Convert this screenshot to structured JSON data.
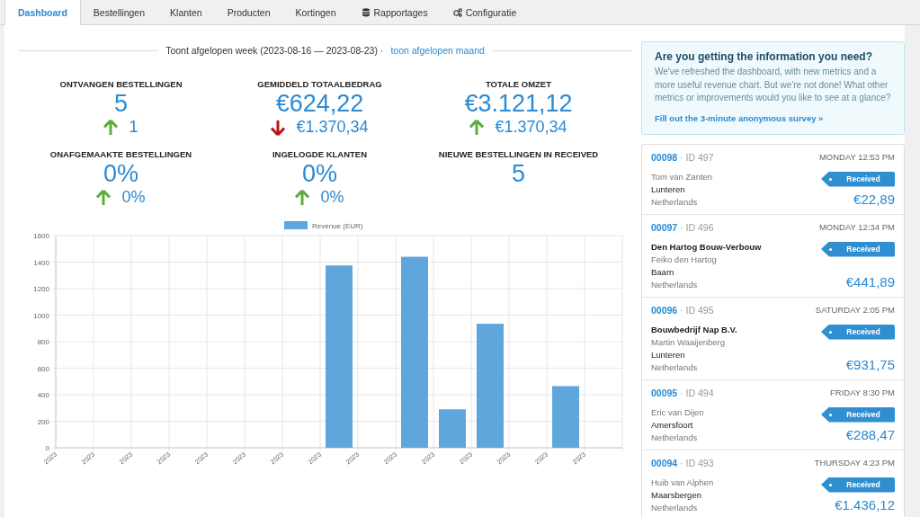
{
  "tabs": [
    {
      "label": "Dashboard",
      "selected": true,
      "kind": "plain"
    },
    {
      "label": "Bestellingen",
      "selected": false,
      "kind": "plain"
    },
    {
      "label": "Klanten",
      "selected": false,
      "kind": "plain"
    },
    {
      "label": "Producten",
      "selected": false,
      "kind": "plain"
    },
    {
      "label": "Kortingen",
      "selected": false,
      "kind": "plain"
    },
    {
      "label": "Rapportages",
      "selected": false,
      "kind": "database"
    },
    {
      "label": "Configuratie",
      "selected": false,
      "kind": "cogs"
    }
  ],
  "period": {
    "text": "Toont afgelopen week (2023-08-16 — 2023-08-23) ·",
    "link": "toon afgelopen maand"
  },
  "metrics": [
    {
      "label": "ONTVANGEN BESTELLINGEN",
      "value": "5",
      "change": {
        "increase": true,
        "text": "1"
      }
    },
    {
      "label": "GEMIDDELD TOTAALBEDRAG",
      "value": "€624,22",
      "change": {
        "increase": false,
        "text": "€1.370,34"
      }
    },
    {
      "label": "TOTALE OMZET",
      "value": "€3.121,12",
      "change": {
        "increase": true,
        "text": "€1.370,34"
      }
    },
    {
      "label": "ONAFGEMAAKTE BESTELLINGEN",
      "value": "0%",
      "change": {
        "increase": true,
        "text": "0%"
      }
    },
    {
      "label": "INGELOGDE KLANTEN",
      "value": "0%",
      "change": {
        "increase": true,
        "text": "0%"
      }
    },
    {
      "label": "NIEUWE BESTELLINGEN IN RECEIVED",
      "value": "5"
    }
  ],
  "chart": {
    "chart_data": {
      "type": "bar",
      "categories": [
        "2023",
        "2023",
        "2023",
        "2023",
        "2023",
        "2023",
        "2023",
        "2023",
        "2023",
        "2023",
        "2023",
        "2023",
        "2023",
        "2023",
        "2023"
      ],
      "series": [
        {
          "name": "Revenue (EUR)",
          "color": "#5ea6dc",
          "values": [
            0,
            0,
            0,
            0,
            0,
            0,
            0,
            1375,
            0,
            1440,
            290,
            935,
            0,
            465,
            0
          ]
        }
      ],
      "grid": true,
      "ylim": [
        0,
        1600
      ],
      "yticks": [
        0,
        200,
        400,
        600,
        800,
        1000,
        1200,
        1400,
        1600
      ]
    }
  },
  "survey": {
    "title": "Are you getting the information you need?",
    "text": "We've refreshed the dashboard, with new metrics and a more useful revenue chart. But we're not done! What other metrics or improvements would you like to see at a glance?",
    "link": "Fill out the 3-minute anonymous survey »"
  },
  "orders": [
    {
      "number": "00098",
      "id": "· ID 497",
      "time": "MONDAY 12:53 PM",
      "contact": "Tom van Zanten",
      "city": "Lunteren",
      "country": "Netherlands",
      "status": "Received",
      "total": "€22,89"
    },
    {
      "number": "00097",
      "id": "· ID 496",
      "time": "MONDAY 12:34 PM",
      "company": "Den Hartog Bouw-Verbouw",
      "contact": "Feiko den Hartog",
      "city": "Baarn",
      "country": "Netherlands",
      "status": "Received",
      "total": "€441,89"
    },
    {
      "number": "00096",
      "id": "· ID 495",
      "time": "SATURDAY 2:05 PM",
      "company": "Bouwbedrijf Nap B.V.",
      "contact": "Martin Waaijenberg",
      "city": "Lunteren",
      "country": "Netherlands",
      "status": "Received",
      "total": "€931,75"
    },
    {
      "number": "00095",
      "id": "· ID 494",
      "time": "FRIDAY 8:30 PM",
      "contact": "Eric van Dijen",
      "city": "Amersfoort",
      "country": "Netherlands",
      "status": "Received",
      "total": "€288,47"
    },
    {
      "number": "00094",
      "id": "· ID 493",
      "time": "THURSDAY 4:23 PM",
      "contact": "Huib van Alphen",
      "city": "Maarsbergen",
      "country": "Netherlands",
      "status": "Received",
      "total": "€1.436,12"
    }
  ]
}
